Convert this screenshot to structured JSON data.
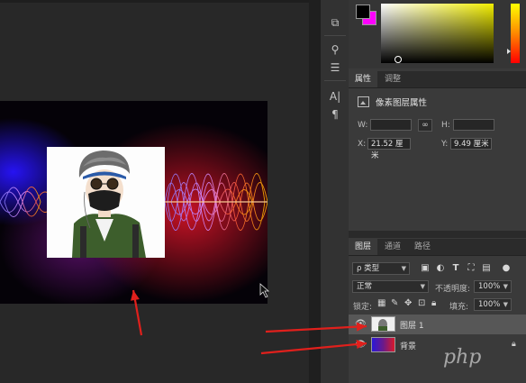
{
  "colors": {
    "foreground": "#000000",
    "background": "#ff00ff",
    "arrow": "#e0201c"
  },
  "properties_panel": {
    "tabs": [
      "属性",
      "调整"
    ],
    "title": "像素图层属性",
    "w_label": "W:",
    "h_label": "H:",
    "x_label": "X:",
    "x_value": "21.52 厘米",
    "y_label": "Y:",
    "y_value": "9.49 厘米",
    "link_icon": "link-icon"
  },
  "layers_panel": {
    "tabs": [
      "图层",
      "通道",
      "路径"
    ],
    "filter_label": "ρ 类型",
    "blend_mode": "正常",
    "opacity_label": "不透明度:",
    "opacity_value": "100%",
    "lock_label": "锁定:",
    "fill_label": "填充:",
    "fill_value": "100%",
    "layers": [
      {
        "name": "图层 1",
        "visible": true,
        "selected": true,
        "locked": false
      },
      {
        "name": "背景",
        "visible": true,
        "selected": false,
        "locked": true
      }
    ]
  },
  "watermark": "php"
}
